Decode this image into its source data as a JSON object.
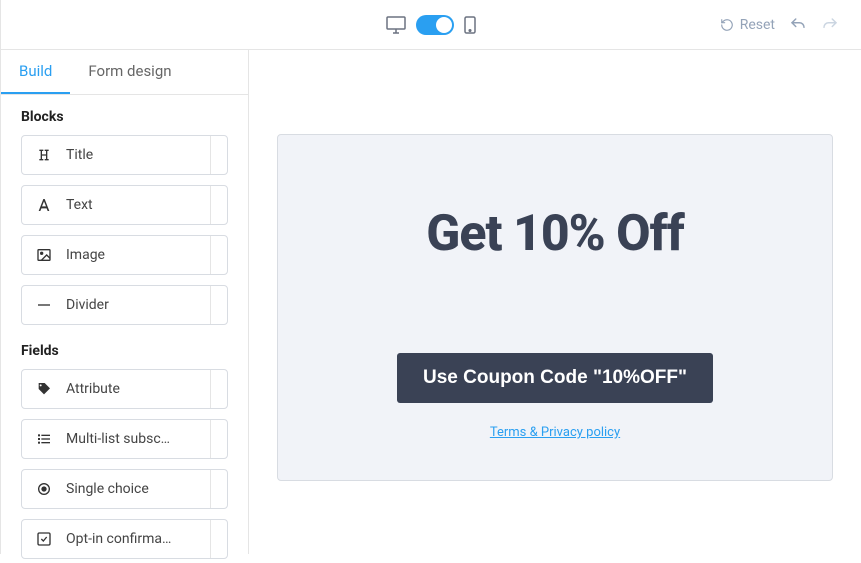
{
  "topbar": {
    "reset_label": "Reset"
  },
  "tabs": {
    "build": "Build",
    "form_design": "Form design"
  },
  "sidebar": {
    "blocks_title": "Blocks",
    "fields_title": "Fields",
    "blocks": [
      {
        "label": "Title"
      },
      {
        "label": "Text"
      },
      {
        "label": "Image"
      },
      {
        "label": "Divider"
      }
    ],
    "fields": [
      {
        "label": "Attribute"
      },
      {
        "label": "Multi-list subsc…"
      },
      {
        "label": "Single choice"
      },
      {
        "label": "Opt-in confirma…"
      }
    ]
  },
  "canvas": {
    "heading": "Get 10% Off",
    "coupon_button": "Use Coupon Code \"10%OFF\"",
    "terms": "Terms & Privacy policy"
  }
}
